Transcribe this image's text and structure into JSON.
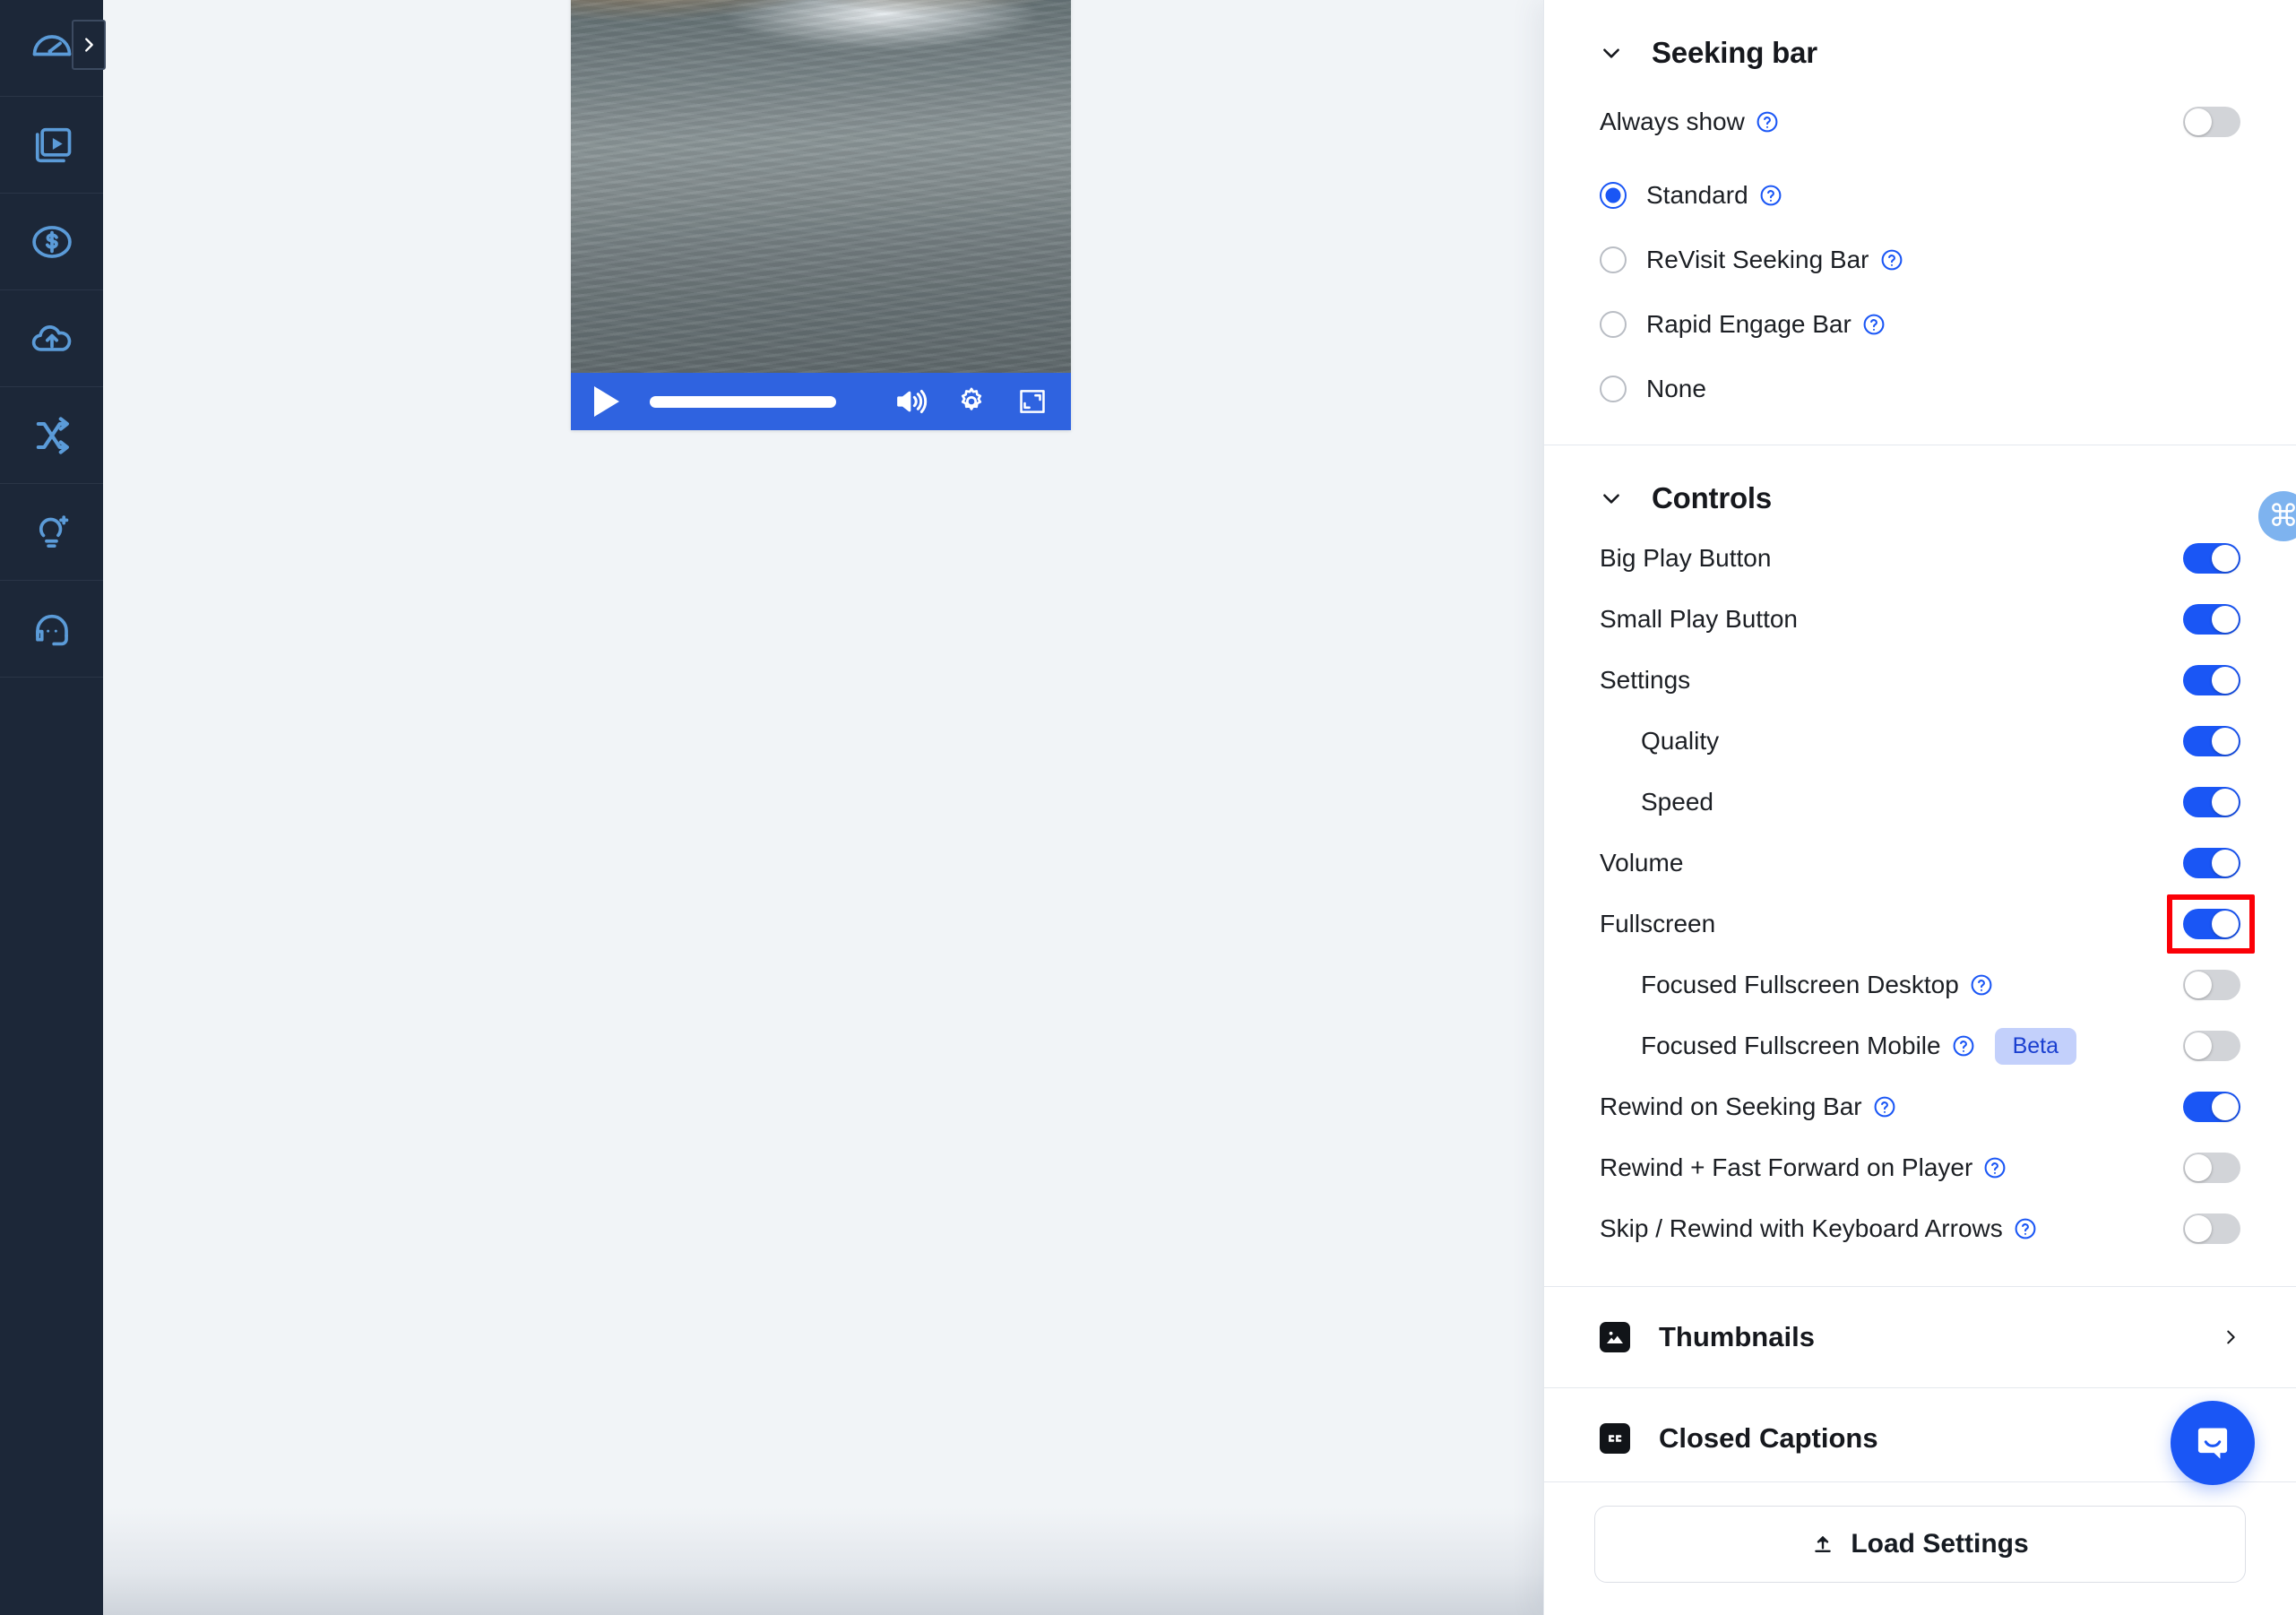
{
  "rail": {
    "expand_button": "chevron-right",
    "items": [
      {
        "name": "dashboard",
        "icon": "speedometer-icon"
      },
      {
        "name": "videos",
        "icon": "video-library-icon"
      },
      {
        "name": "monetization",
        "icon": "dollar-coin-icon"
      },
      {
        "name": "upload",
        "icon": "cloud-upload-icon"
      },
      {
        "name": "shuffle",
        "icon": "shuffle-arrows-icon"
      },
      {
        "name": "ai-ideas",
        "icon": "lightbulb-sparkle-icon"
      },
      {
        "name": "support",
        "icon": "headset-icon"
      }
    ]
  },
  "player": {
    "play_label": "play-icon",
    "volume_label": "volume-icon",
    "settings_label": "gear-icon",
    "fullscreen_label": "fullscreen-icon"
  },
  "panel": {
    "seeking_bar": {
      "title": "Seeking bar",
      "rows": [
        {
          "label": "Always show",
          "help": true,
          "state": "off"
        }
      ],
      "radio_options": [
        {
          "label": "Standard",
          "help": true,
          "selected": true
        },
        {
          "label": "ReVisit Seeking Bar",
          "help": true,
          "selected": false
        },
        {
          "label": "Rapid Engage Bar",
          "help": true,
          "selected": false
        },
        {
          "label": "None",
          "help": false,
          "selected": false
        }
      ]
    },
    "controls": {
      "title": "Controls",
      "rows": [
        {
          "label": "Big Play Button",
          "help": false,
          "state": "on",
          "indent": 0,
          "badge": null
        },
        {
          "label": "Small Play Button",
          "help": false,
          "state": "on",
          "indent": 0,
          "badge": null
        },
        {
          "label": "Settings",
          "help": false,
          "state": "on",
          "indent": 0,
          "badge": null
        },
        {
          "label": "Quality",
          "help": false,
          "state": "on",
          "indent": 1,
          "badge": null
        },
        {
          "label": "Speed",
          "help": false,
          "state": "on",
          "indent": 1,
          "badge": null
        },
        {
          "label": "Volume",
          "help": false,
          "state": "on",
          "indent": 0,
          "badge": null
        },
        {
          "label": "Fullscreen",
          "help": false,
          "state": "on",
          "indent": 0,
          "badge": null,
          "highlighted": true
        },
        {
          "label": "Focused Fullscreen Desktop",
          "help": true,
          "state": "off",
          "indent": 1,
          "badge": null
        },
        {
          "label": "Focused Fullscreen Mobile",
          "help": true,
          "state": "off",
          "indent": 1,
          "badge": "Beta"
        },
        {
          "label": "Rewind on Seeking Bar",
          "help": true,
          "state": "on",
          "indent": 0,
          "badge": null
        },
        {
          "label": "Rewind + Fast Forward on Player",
          "help": true,
          "state": "off",
          "indent": 0,
          "badge": null
        },
        {
          "label": "Skip / Rewind with Keyboard Arrows",
          "help": true,
          "state": "off",
          "indent": 0,
          "badge": null
        }
      ]
    },
    "nav_sections": [
      {
        "label": "Thumbnails",
        "icon": "image-icon",
        "chevron": "chevron-right"
      },
      {
        "label": "Closed Captions",
        "icon": "closed-captions-icon",
        "chevron": null
      }
    ],
    "footer": {
      "load_settings_label": "Load Settings",
      "load_settings_icon": "upload-arrow-icon"
    }
  },
  "floating": {
    "command_badge": "⌘",
    "intercom": "intercom-messenger-icon"
  },
  "colors": {
    "accent_blue": "#1a56f5",
    "player_bar_blue": "#2f63e0",
    "rail_dark": "#1c2738",
    "rail_icon": "#5b9bd8",
    "canvas_bg": "#f1f4f7",
    "toggle_off": "#d2d4d8",
    "highlight_red": "#fb0007",
    "beta_badge_bg": "#c3d0fb",
    "beta_badge_text": "#1a3fd0"
  }
}
